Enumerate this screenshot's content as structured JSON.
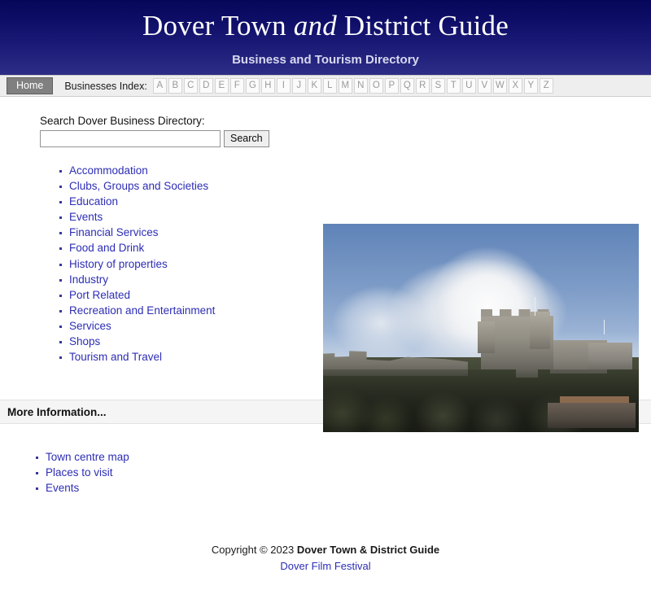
{
  "banner": {
    "title_part1": "Dover Town ",
    "title_italic": "and",
    "title_part2": " District Guide",
    "subtitle": "Business and Tourism Directory",
    "gradient_top": "#060659",
    "gradient_bottom": "#2d2d86",
    "title_color": "#ffffff",
    "subtitle_color": "#d8d8f0"
  },
  "nav": {
    "home_label": "Home",
    "index_label": "Businesses Index:",
    "letters": [
      "A",
      "B",
      "C",
      "D",
      "E",
      "F",
      "G",
      "H",
      "I",
      "J",
      "K",
      "L",
      "M",
      "N",
      "O",
      "P",
      "Q",
      "R",
      "S",
      "T",
      "U",
      "V",
      "W",
      "X",
      "Y",
      "Z"
    ]
  },
  "search": {
    "label": "Search Dover Business Directory:",
    "value": "",
    "placeholder": "",
    "button_label": "Search"
  },
  "categories": [
    {
      "label": "Accommodation"
    },
    {
      "label": "Clubs, Groups and Societies"
    },
    {
      "label": "Education"
    },
    {
      "label": "Events"
    },
    {
      "label": "Financial Services"
    },
    {
      "label": "Food and Drink"
    },
    {
      "label": "History of properties"
    },
    {
      "label": "Industry"
    },
    {
      "label": "Port Related"
    },
    {
      "label": "Recreation and Entertainment"
    },
    {
      "label": "Services"
    },
    {
      "label": "Shops"
    },
    {
      "label": "Tourism and Travel"
    }
  ],
  "photo": {
    "alt": "Dover Castle on the hill under a blue sky with white clouds"
  },
  "more_information": {
    "heading": "More Information...",
    "links": [
      {
        "label": "Town centre map"
      },
      {
        "label": "Places to visit"
      },
      {
        "label": "Events"
      }
    ]
  },
  "footer": {
    "copyright_prefix": "Copyright © 2023 ",
    "copyright_bold": "Dover Town & District Guide",
    "link_label": "Dover Film Festival",
    "link_color": "#2d2db5"
  }
}
